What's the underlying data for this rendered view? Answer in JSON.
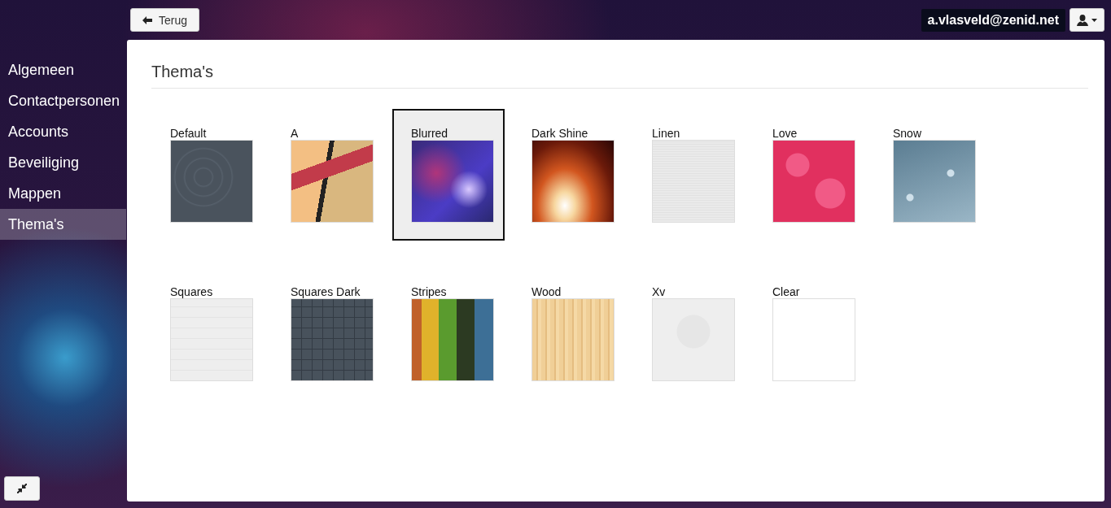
{
  "top_bar": {
    "back_button": "Terug",
    "user_email": "a.vlasveld@zenid.net"
  },
  "sidebar": {
    "items": [
      {
        "label": "Algemeen",
        "selected": false
      },
      {
        "label": "Contactpersonen",
        "selected": false
      },
      {
        "label": "Accounts",
        "selected": false
      },
      {
        "label": "Beveiliging",
        "selected": false
      },
      {
        "label": "Mappen",
        "selected": false
      },
      {
        "label": "Thema's",
        "selected": true
      }
    ]
  },
  "panel": {
    "title": "Thema's",
    "themes": [
      {
        "label": "Default",
        "kind": "rings",
        "selected": false
      },
      {
        "label": "A",
        "kind": "panels",
        "selected": false
      },
      {
        "label": "Blurred",
        "kind": "blur",
        "selected": true
      },
      {
        "label": "Dark Shine",
        "kind": "glow",
        "selected": false
      },
      {
        "label": "Linen",
        "kind": "linen",
        "selected": false
      },
      {
        "label": "Love",
        "kind": "flowers",
        "selected": false
      },
      {
        "label": "Snow",
        "kind": "snow",
        "selected": false
      },
      {
        "label": "Squares",
        "kind": "tiles",
        "selected": false
      },
      {
        "label": "Squares Dark",
        "kind": "darktiles",
        "selected": false
      },
      {
        "label": "Stripes",
        "kind": "stripes",
        "selected": false
      },
      {
        "label": "Wood",
        "kind": "wood",
        "selected": false
      },
      {
        "label": "Xv",
        "kind": "floral",
        "selected": false
      },
      {
        "label": "Clear",
        "kind": "blank",
        "selected": false
      }
    ]
  }
}
